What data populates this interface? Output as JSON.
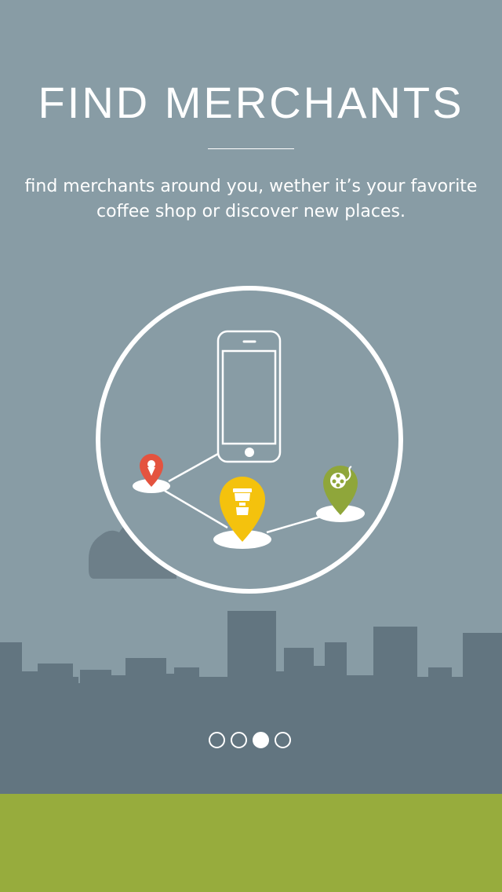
{
  "header": {
    "title": "FIND MERCHANTS",
    "subtitle": "find merchants around you, wether it’s your favorite coffee shop or discover new places."
  },
  "pagination": {
    "total": 4,
    "active_index": 2
  },
  "illustration": {
    "pins": [
      {
        "icon": "ice-cream-icon",
        "color": "#e4533f"
      },
      {
        "icon": "coffee-cup-icon",
        "color": "#f4c20d"
      },
      {
        "icon": "film-reel-icon",
        "color": "#8fa63a"
      }
    ]
  },
  "colors": {
    "sky": "#889ca5",
    "skyline": "#627580",
    "ground": "#97ac3d",
    "accent_white": "#ffffff"
  }
}
